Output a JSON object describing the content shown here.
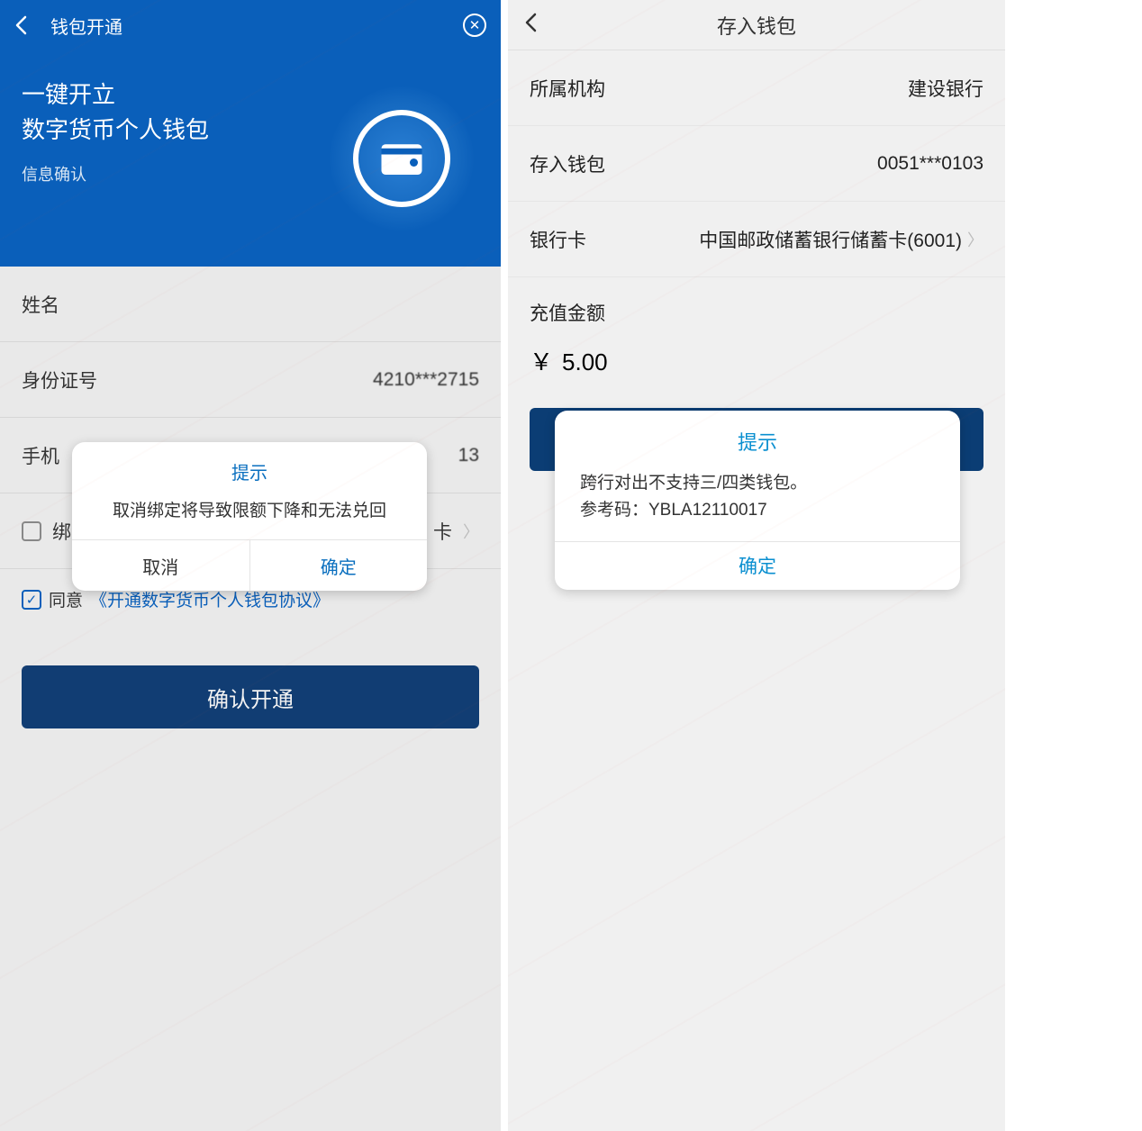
{
  "left": {
    "header_title": "钱包开通",
    "hero_line1": "一键开立",
    "hero_line2": "数字货币个人钱包",
    "hero_sub": "信息确认",
    "form": {
      "name_label": "姓名",
      "id_label": "身份证号",
      "id_value": "4210***2715",
      "phone_label": "手机",
      "phone_value_suffix": "13",
      "card_label": "绑",
      "card_suffix": "卡"
    },
    "agree": {
      "prefix": "同意",
      "link": "《开通数字货币个人钱包协议》"
    },
    "confirm_button": "确认开通",
    "dialog": {
      "title": "提示",
      "message": "取消绑定将导致限额下降和无法兑回",
      "cancel": "取消",
      "ok": "确定"
    }
  },
  "right": {
    "header_title": "存入钱包",
    "rows": {
      "org_label": "所属机构",
      "org_value": "建设银行",
      "wallet_label": "存入钱包",
      "wallet_value": "0051***0103",
      "card_label": "银行卡",
      "card_value": "中国邮政储蓄银行储蓄卡(6001)"
    },
    "amount_label": "充值金额",
    "amount_currency": "￥",
    "amount_value": "5.00",
    "dialog": {
      "title": "提示",
      "msg_line1": "跨行对出不支持三/四类钱包。",
      "msg_line2": "参考码：YBLA12110017",
      "ok": "确定"
    }
  }
}
